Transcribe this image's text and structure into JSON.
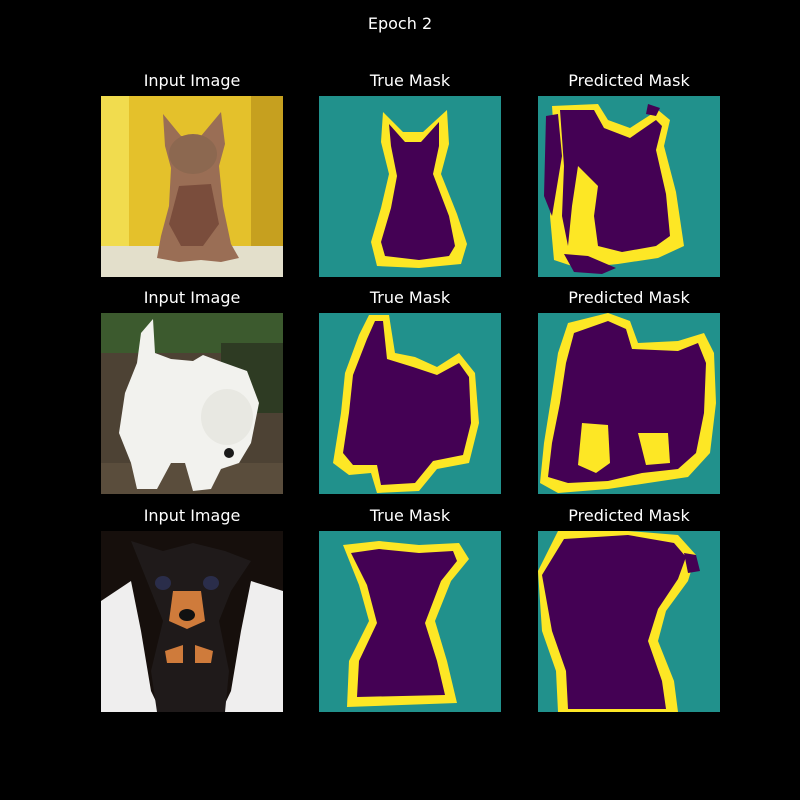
{
  "figure": {
    "title": "Epoch 2",
    "column_titles": [
      "Input Image",
      "True Mask",
      "Predicted Mask"
    ]
  },
  "colors": {
    "background": "#000000",
    "mask_background": "#21918c",
    "mask_object": "#440154",
    "mask_border": "#fde725"
  },
  "rows": [
    {
      "subject": "sphynx cat",
      "input_palette": [
        "#e9c72a",
        "#c9a01c",
        "#9a6e55",
        "#e6e2cf"
      ]
    },
    {
      "subject": "white west highland terrier",
      "input_palette": [
        "#4f4436",
        "#f2f2ee",
        "#3c5a2e",
        "#2a241f"
      ]
    },
    {
      "subject": "miniature pinscher puppy",
      "input_palette": [
        "#160f0c",
        "#f1f0f0",
        "#cf7b3b",
        "#1f1a1a"
      ]
    }
  ]
}
